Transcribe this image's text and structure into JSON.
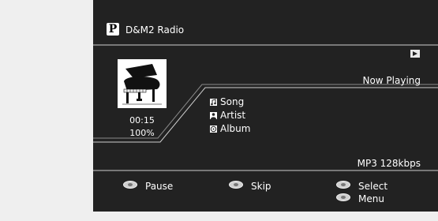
{
  "header": {
    "logo_letter": "P",
    "title": "D&M2 Radio"
  },
  "status": {
    "play_icon": "play-icon",
    "label": "Now Playing"
  },
  "album_art": {
    "icon": "grand-piano-image"
  },
  "playback": {
    "time": "00:15",
    "buffer": "100%"
  },
  "track_info": [
    {
      "icon": "music-note-icon",
      "label": "Song"
    },
    {
      "icon": "artist-icon",
      "label": "Artist"
    },
    {
      "icon": "album-icon",
      "label": "Album"
    }
  ],
  "format": "MP3 128kbps",
  "controls": [
    {
      "icon": "remote-button-icon",
      "label": "Pause"
    },
    {
      "icon": "remote-button-icon",
      "label": "Skip"
    },
    {
      "icon": "remote-button-icon",
      "label": "Select"
    },
    {
      "icon": "remote-button-icon",
      "label": "Menu"
    }
  ],
  "colors": {
    "screen_bg": "#222222",
    "page_bg": "#efefef",
    "text": "#ffffff"
  }
}
